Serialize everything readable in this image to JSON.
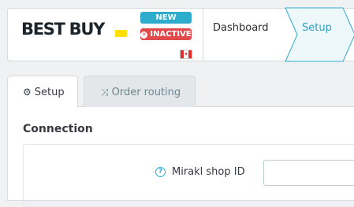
{
  "header": {
    "logo_text": "BEST BUY",
    "badges": {
      "new": "NEW",
      "inactive": "INACTIVE"
    },
    "country_flag": "canada-flag-icon",
    "steps": [
      {
        "label": "Dashboard",
        "active": false
      },
      {
        "label": "Setup",
        "active": true
      }
    ]
  },
  "tabs": [
    {
      "label": "Setup",
      "icon": "gear-icon",
      "active": true
    },
    {
      "label": "Order routing",
      "icon": "shuffle-icon",
      "active": false
    }
  ],
  "section": {
    "title": "Connection",
    "fields": [
      {
        "label": "Mirakl shop ID",
        "value": "",
        "placeholder": ""
      }
    ]
  },
  "colors": {
    "accent": "#2eacce",
    "inactive": "#e2494b",
    "logo_tag": "#ffe000"
  }
}
